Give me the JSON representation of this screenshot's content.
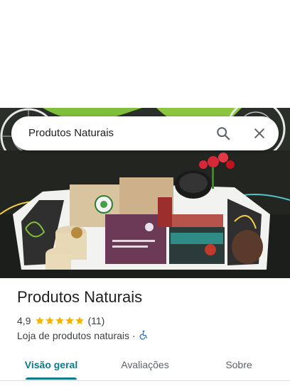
{
  "search": {
    "query": "Produtos Naturais"
  },
  "place": {
    "name": "Produtos Naturais",
    "rating": "4,9",
    "rating_value": 4.9,
    "review_count": "(11)",
    "category": "Loja de produtos naturais",
    "separator": "·",
    "accessibility_icon": "wheelchair-icon"
  },
  "tabs": [
    {
      "label": "Visão geral",
      "active": true
    },
    {
      "label": "Avaliações",
      "active": false
    },
    {
      "label": "Sobre",
      "active": false
    }
  ],
  "colors": {
    "accent": "#0b7a8a",
    "star": "#f4b400",
    "accessibility": "#1a73e8"
  }
}
